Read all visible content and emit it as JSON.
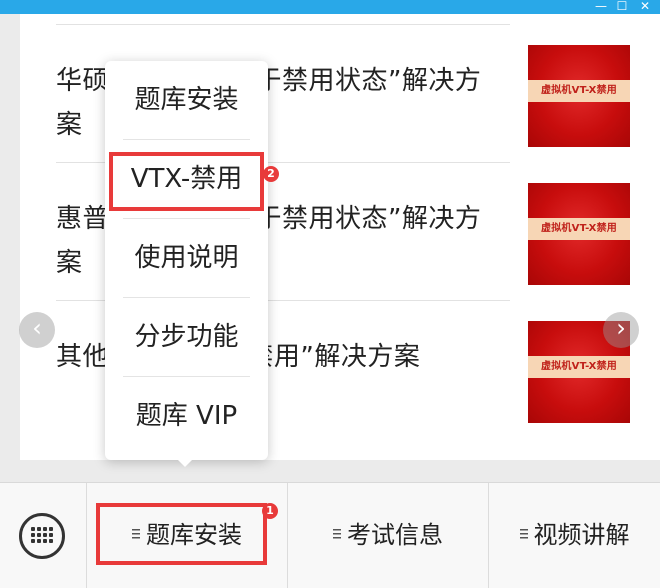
{
  "window": {
    "minimize_glyph": "—",
    "maximize_glyph": "☐",
    "close_glyph": "✕"
  },
  "articles": [
    {
      "title": "华硕电脑“VTX处于禁用状态”解决方案",
      "thumb_text": "虚拟机VT-X禁用"
    },
    {
      "title": "惠普电脑“VTX处于禁用状态”解决方案",
      "thumb_text": "虚拟机VT-X禁用"
    },
    {
      "title": "其他电脑“VTX--禁用”解决方案",
      "thumb_text": "虚拟机VT-X禁用"
    }
  ],
  "carousel": {
    "prev_glyph": "‹",
    "next_glyph": "›"
  },
  "menu": {
    "items": [
      {
        "label": "题库安装"
      },
      {
        "label": "VTX-禁用"
      },
      {
        "label": "使用说明"
      },
      {
        "label": "分步功能"
      },
      {
        "label": "题库 VIP"
      }
    ]
  },
  "annotations": {
    "step1": "1",
    "step2": "2",
    "color": "#e83a3a"
  },
  "bottom_bar": {
    "keyboard_icon": "keyboard-icon",
    "tabs": [
      {
        "label": "题库安装"
      },
      {
        "label": "考试信息"
      },
      {
        "label": "视频讲解"
      }
    ]
  },
  "colors": {
    "titlebar": "#29a8e8",
    "thumbnail_red": "#c80d0d",
    "annotation_red": "#e83a3a"
  }
}
